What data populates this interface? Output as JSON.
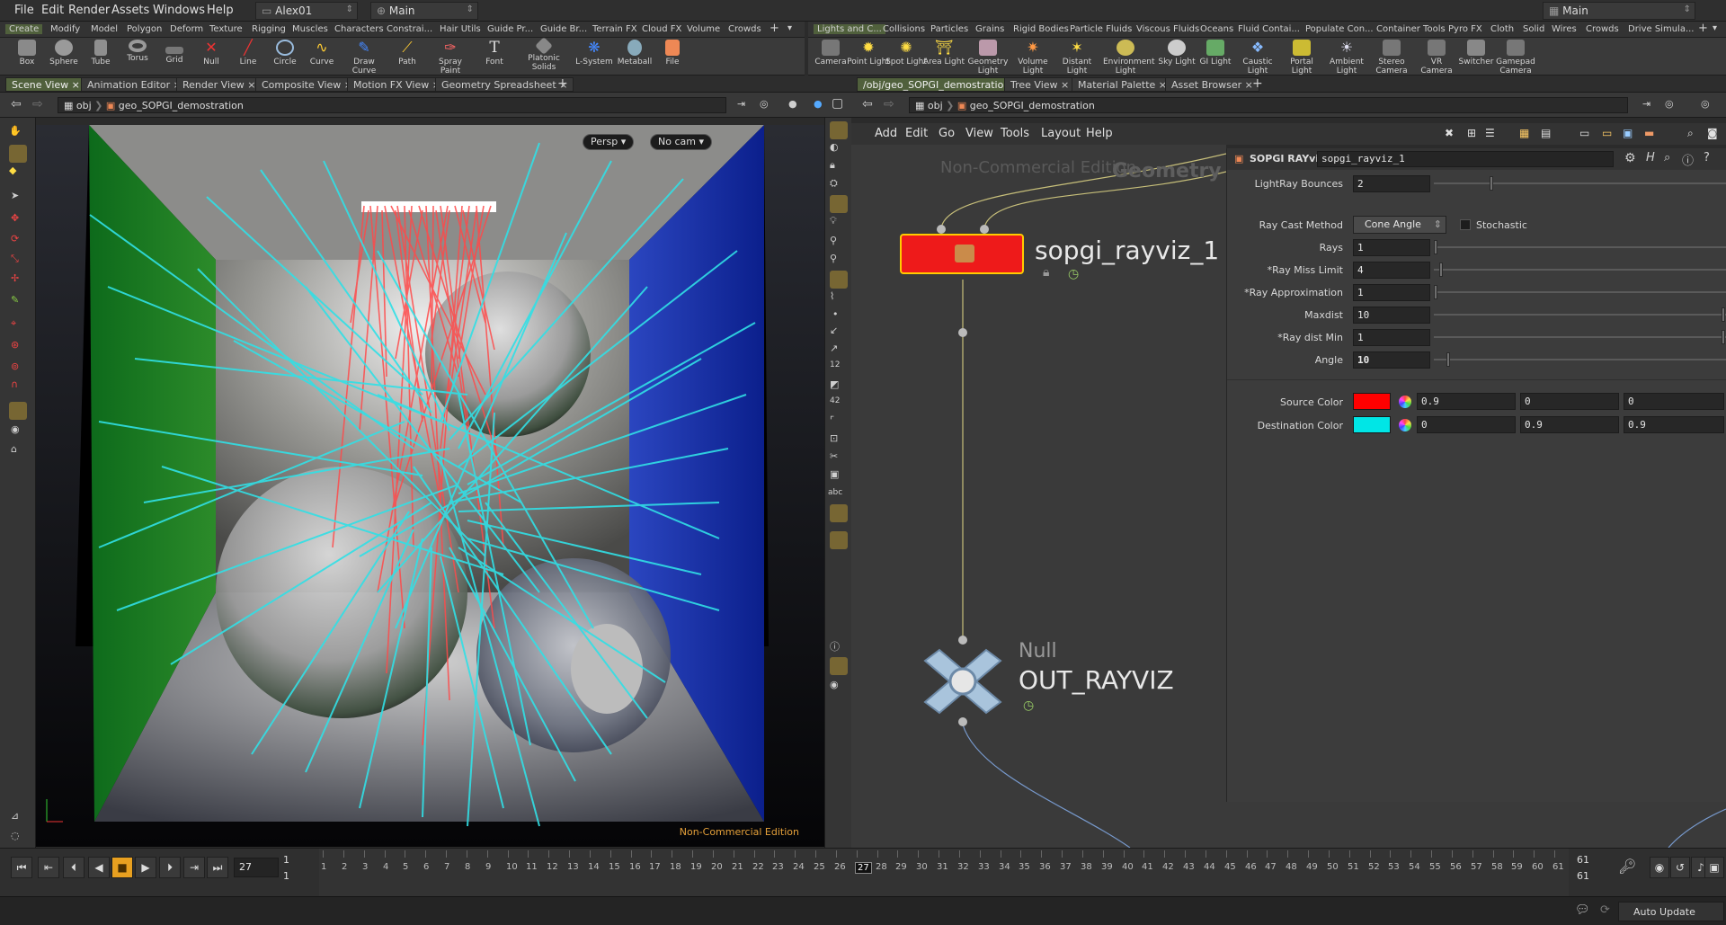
{
  "menubar": {
    "items": [
      "File",
      "Edit",
      "Render",
      "Assets",
      "Windows",
      "Help"
    ],
    "user": "Alex01",
    "desktop": "Main",
    "right_desktop": "Main"
  },
  "shelf_left": {
    "tabs": [
      "Create",
      "Modify",
      "Model",
      "Polygon",
      "Deform",
      "Texture",
      "Rigging",
      "Muscles",
      "Characters",
      "Constrai...",
      "Hair Utils",
      "Guide Pr...",
      "Guide Br...",
      "Terrain FX",
      "Cloud FX",
      "Volume",
      "Crowds"
    ],
    "tools": [
      "Box",
      "Sphere",
      "Tube",
      "Torus",
      "Grid",
      "Null",
      "Line",
      "Circle",
      "Curve",
      "Draw Curve",
      "Path",
      "Spray Paint",
      "Font",
      "Platonic Solids",
      "L-System",
      "Metaball",
      "File"
    ]
  },
  "shelf_right": {
    "tabs": [
      "Lights and C...",
      "Collisions",
      "Particles",
      "Grains",
      "Rigid Bodies",
      "Particle Fluids",
      "Viscous Fluids",
      "Oceans",
      "Fluid Contai...",
      "Populate Con...",
      "Container Tools",
      "Pyro FX",
      "Cloth",
      "Solid",
      "Wires",
      "Crowds",
      "Drive Simula..."
    ],
    "tools": [
      "Camera",
      "Point Light",
      "Spot Light",
      "Area Light",
      "Geometry Light",
      "Volume Light",
      "Distant Light",
      "Environment Light",
      "Sky Light",
      "GI Light",
      "Caustic Light",
      "Portal Light",
      "Ambient Light",
      "Stereo Camera",
      "VR Camera",
      "Switcher",
      "Gamepad Camera"
    ]
  },
  "left_pane": {
    "tabs": [
      "Scene View",
      "Animation Editor",
      "Render View",
      "Composite View",
      "Motion FX View",
      "Geometry Spreadsheet"
    ],
    "path_root": "obj",
    "path_node": "geo_SOPGI_demostration",
    "persp": "Persp",
    "cam": "No cam",
    "watermark": "Non-Commercial Edition"
  },
  "right_pane": {
    "tabs": [
      "/obj/geo_SOPGI_demostration",
      "Tree View",
      "Material Palette",
      "Asset Browser"
    ],
    "path_root": "obj",
    "path_node": "geo_SOPGI_demostration",
    "menu": [
      "Add",
      "Edit",
      "Go",
      "View",
      "Tools",
      "Layout",
      "Help"
    ],
    "watermark": "Non-Commercial Edition",
    "context_label": "Geometry"
  },
  "network": {
    "node1_name": "sopgi_rayviz_1",
    "node2_type": "Null",
    "node2_name": "OUT_RAYVIZ"
  },
  "params": {
    "node_type": "SOPGI RAYviz",
    "node_name": "sopgi_rayviz_1",
    "light_bounces_label": "LightRay Bounces",
    "light_bounces": "2",
    "ray_cast_label": "Ray Cast Method",
    "ray_cast": "Cone Angle",
    "stochastic_label": "Stochastic",
    "rays_label": "Rays",
    "rays": "1",
    "miss_label": "*Ray Miss Limit",
    "miss": "4",
    "approx_label": "*Ray Approximation",
    "approx": "1",
    "maxdist_label": "Maxdist",
    "maxdist": "10",
    "distmin_label": "*Ray dist Min",
    "distmin": "1",
    "angle_label": "Angle",
    "angle": "10",
    "source_color_label": "Source Color",
    "source_color": [
      "0.9",
      "0",
      "0"
    ],
    "dest_color_label": "Destination Color",
    "dest_color": [
      "0",
      "0.9",
      "0.9"
    ],
    "source_hex": "#ff0000",
    "dest_hex": "#00e6e6"
  },
  "timeline": {
    "current_frame": "27",
    "start": "1",
    "start2": "1",
    "end": "61",
    "end2": "61",
    "auto_update": "Auto Update",
    "ticks": [
      "1",
      "2",
      "3",
      "4",
      "5",
      "6",
      "7",
      "8",
      "9",
      "10",
      "11",
      "12",
      "13",
      "14",
      "15",
      "16",
      "17",
      "18",
      "19",
      "20",
      "21",
      "22",
      "23",
      "24",
      "25",
      "26",
      "27",
      "28",
      "29",
      "30",
      "31",
      "32",
      "33",
      "34",
      "35",
      "36",
      "37",
      "38",
      "39",
      "40",
      "41",
      "42",
      "43",
      "44",
      "45",
      "46",
      "47",
      "48",
      "49",
      "50",
      "51",
      "52",
      "53",
      "54",
      "55",
      "56",
      "57",
      "58",
      "59",
      "60",
      "61"
    ]
  }
}
